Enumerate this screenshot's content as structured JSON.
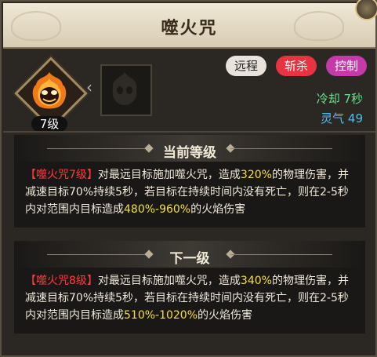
{
  "title": "噬火咒",
  "skill": {
    "level": "7级",
    "icon": "fire-skull-icon",
    "next_icon": "locked-flame-icon"
  },
  "tags": {
    "ranged": "远程",
    "kill": "斩杀",
    "control": "控制"
  },
  "stats": {
    "cooldown": "冷却 7秒",
    "aura": "灵气 49"
  },
  "current": {
    "heading": "当前等级",
    "name": "【噬火咒7级】",
    "part1": "对最远目标施加噬火咒，造成",
    "dmg": "320%",
    "part2": "的物理伤害，并减速目标70%持续5秒，若目标在持续时间内没有死亡，则在2-5秒内对范围内目标造成",
    "fire": "480%-960%",
    "part3": "的火焰伤害"
  },
  "next": {
    "heading": "下一级",
    "name": "【噬火咒8级】",
    "part1": "对最远目标施加噬火咒，造成",
    "dmg": "340%",
    "part2": "的物理伤害，并减速目标70%持续5秒，若目标在持续时间内没有死亡，则在2-5秒内对范围内目标造成",
    "fire": "510%-1020%",
    "part3": "的火焰伤害"
  },
  "colors": {
    "skill_name": "#ff3b3b",
    "highlight": "#f3e03c",
    "cooldown": "#67e28e",
    "aura": "#4ec0ec",
    "tag_kill": "#e83440",
    "tag_control": "#c43aa8"
  }
}
